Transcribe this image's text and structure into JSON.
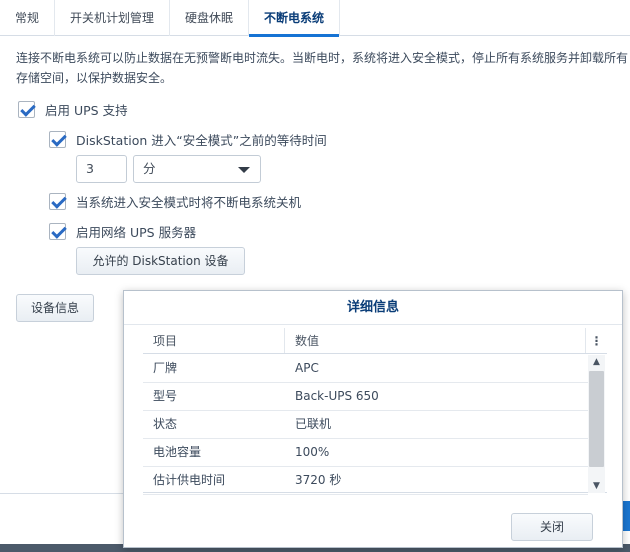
{
  "tabs": [
    {
      "label": "常规"
    },
    {
      "label": "开关机计划管理"
    },
    {
      "label": "硬盘休眠"
    },
    {
      "label": "不断电系统"
    }
  ],
  "description": "连接不断电系统可以防止数据在无预警断电时流失。当断电时，系统将进入安全模式，停止所有系统服务并卸载所有存储空间，以保护数据安全。",
  "enable_ups": {
    "label": "启用 UPS 支持",
    "checked": true
  },
  "safe_mode_wait": {
    "label": "DiskStation 进入“安全模式”之前的等待时间",
    "checked": true
  },
  "wait_value": "3",
  "wait_unit": "分",
  "shutdown_ups": {
    "label": "当系统进入安全模式时将不断电系统关机",
    "checked": true
  },
  "network_ups": {
    "label": "启用网络 UPS 服务器",
    "checked": true
  },
  "allowed_devices_button": "允许的 DiskStation 设备",
  "device_info_button": "设备信息",
  "dialog": {
    "title": "详细信息",
    "columns": [
      "项目",
      "数值"
    ],
    "rows": [
      {
        "item": "厂牌",
        "value": "APC"
      },
      {
        "item": "型号",
        "value": "Back-UPS 650"
      },
      {
        "item": "状态",
        "value": "已联机"
      },
      {
        "item": "电池容量",
        "value": "100%"
      },
      {
        "item": "估计供电时间",
        "value": "3720 秒"
      }
    ],
    "close_button": "关闭"
  }
}
